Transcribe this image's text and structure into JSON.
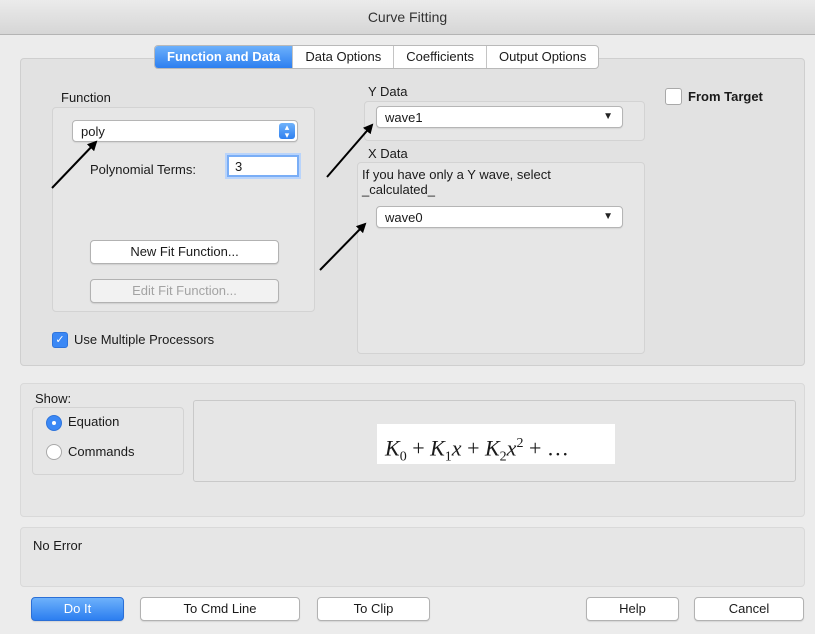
{
  "window": {
    "title": "Curve Fitting"
  },
  "tabs": [
    {
      "label": "Function and Data",
      "active": true
    },
    {
      "label": "Data Options",
      "active": false
    },
    {
      "label": "Coefficients",
      "active": false
    },
    {
      "label": "Output Options",
      "active": false
    }
  ],
  "function": {
    "label": "Function",
    "selected": "poly",
    "poly_terms_label": "Polynomial Terms:",
    "poly_terms_value": "3",
    "new_fit_label": "New Fit Function...",
    "edit_fit_label": "Edit Fit Function..."
  },
  "ydata": {
    "label": "Y Data",
    "selected": "wave1"
  },
  "xdata": {
    "label": "X Data",
    "hint": "If you have only a Y wave, select _calculated_",
    "selected": "wave0"
  },
  "from_target": {
    "label": "From Target",
    "checked": false
  },
  "multiproc": {
    "label": "Use Multiple Processors",
    "checked": true
  },
  "show": {
    "label": "Show:",
    "equation_label": "Equation",
    "commands_label": "Commands",
    "selected": "Equation"
  },
  "equation": {
    "k0": "K",
    "s0": "0",
    "op1": " + ",
    "k1": "K",
    "s1": "1",
    "x1": "x",
    "op2": " + ",
    "k2": "K",
    "s2": "2",
    "x2": "x",
    "p2": "2",
    "tail": " + …"
  },
  "status": {
    "message": "No Error"
  },
  "buttons": {
    "do_it": "Do It",
    "to_cmd": "To Cmd Line",
    "to_clip": "To Clip",
    "help": "Help",
    "cancel": "Cancel"
  },
  "colors": {
    "accent": "#2d7ff0",
    "panel": "#e2e2e2",
    "background": "#ececec"
  },
  "icons": {
    "checkmark": "checkmark-icon",
    "stepper": "stepper-icon",
    "dropdown": "dropdown-triangle-icon",
    "arrow": "annotation-arrow-icon"
  }
}
